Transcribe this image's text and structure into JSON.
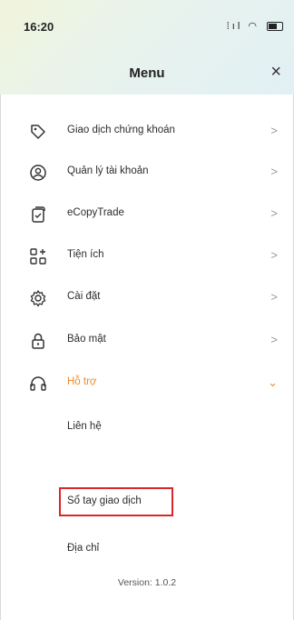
{
  "status_bar": {
    "time": "16:20",
    "signal": "ᐧıl",
    "wifi": "ᯤ"
  },
  "header": {
    "title": "Menu",
    "close_icon": "×"
  },
  "menu": {
    "items": [
      {
        "label": "Giao dịch chứng khoán",
        "icon": "tag-icon",
        "chevron": ">"
      },
      {
        "label": "Quản lý tài khoản",
        "icon": "user-circle-icon",
        "chevron": ">"
      },
      {
        "label": "eCopyTrade",
        "icon": "copy-document-icon",
        "chevron": ">"
      },
      {
        "label": "Tiện ích",
        "icon": "grid-plus-icon",
        "chevron": ">"
      },
      {
        "label": "Cài đặt",
        "icon": "gear-icon",
        "chevron": ">"
      },
      {
        "label": "Bảo mật",
        "icon": "lock-icon",
        "chevron": ">"
      },
      {
        "label": "Hỗ trợ",
        "icon": "headset-icon",
        "chevron": "⌄",
        "expanded": true
      }
    ],
    "support_submenu": [
      "Liên hệ",
      "Sổ tay giao dịch",
      "Địa chỉ"
    ]
  },
  "version": "Version: 1.0.2",
  "colors": {
    "accent": "#ee8a2a",
    "highlight": "#d9262a"
  }
}
